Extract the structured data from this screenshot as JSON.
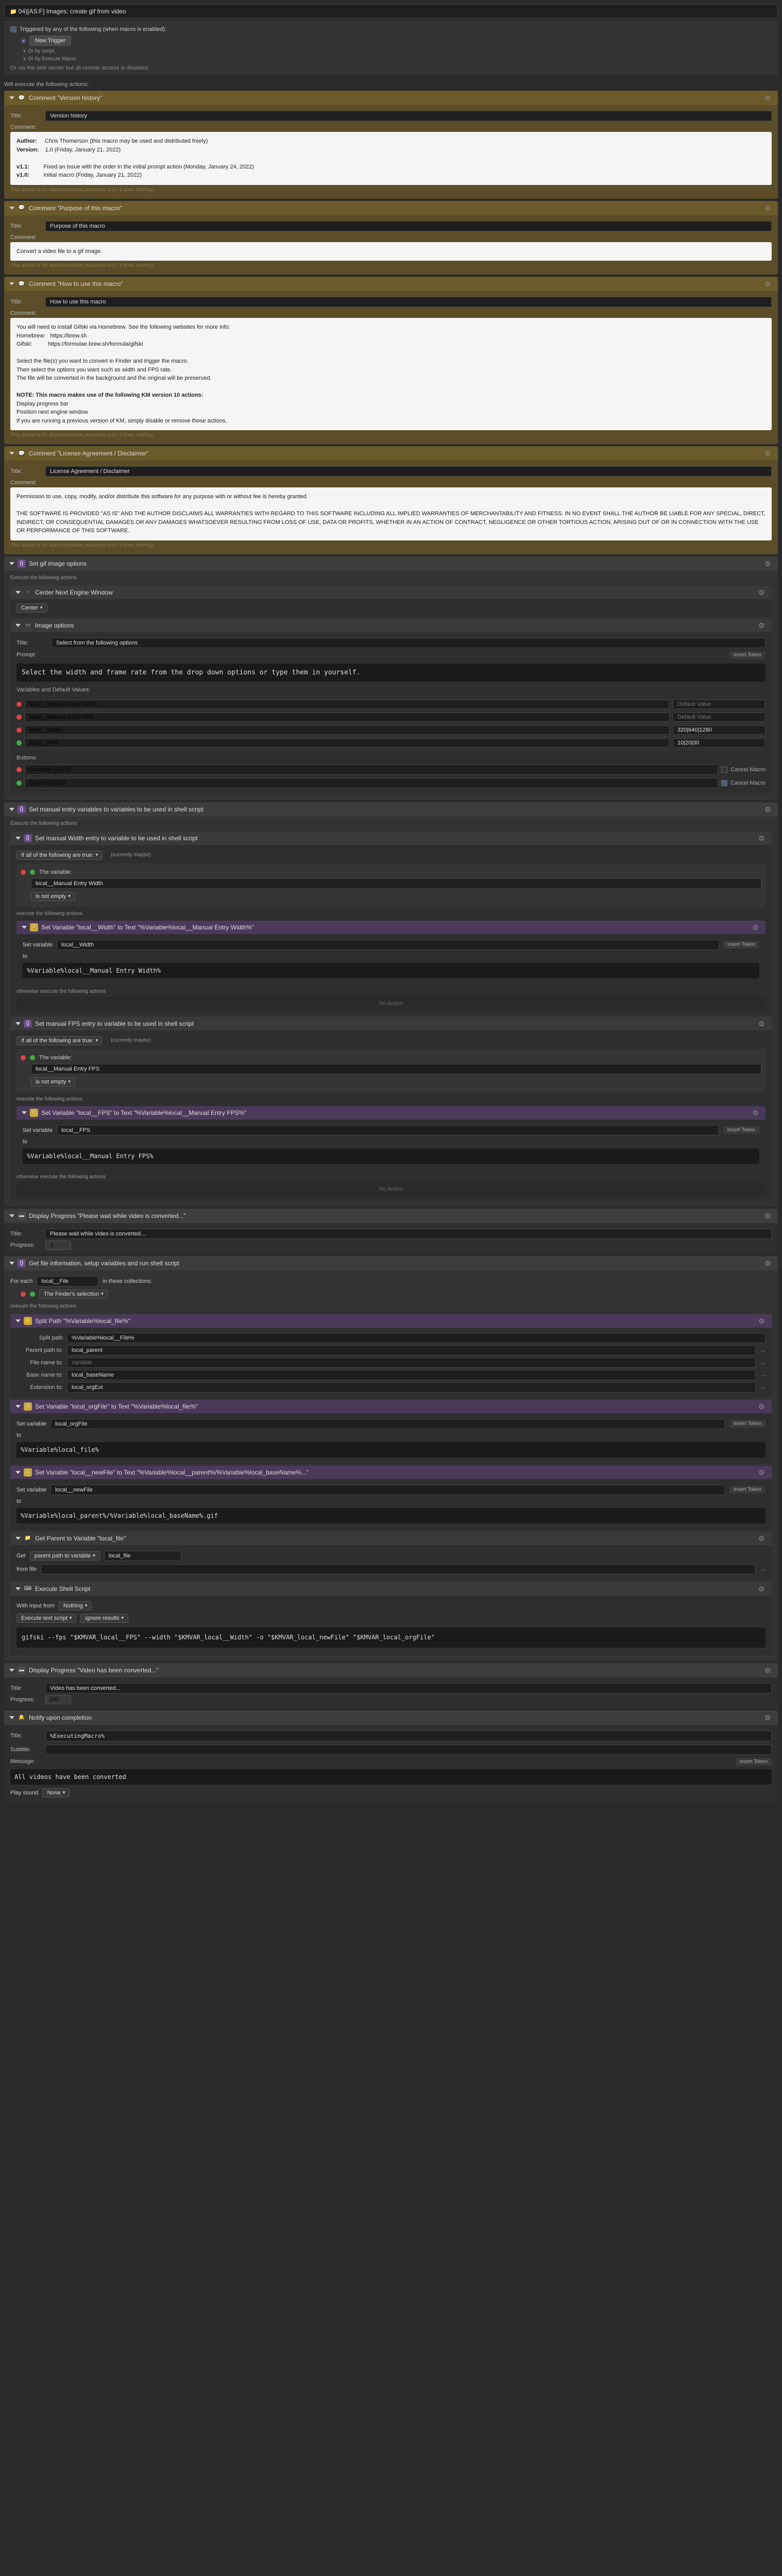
{
  "macro": {
    "title": "04)[AS:F] Images: create gif from video"
  },
  "trigger": {
    "heading": "Triggered by any of the following (when macro is enabled):",
    "new": "New Trigger",
    "sub1": "∨ Or by script,",
    "sub2": "∨ Or by Execute Macro",
    "note": "Or via the web server but all remote access is disabled."
  },
  "exec_label": "Will execute the following actions:",
  "c1": {
    "title": "Comment \"Version history\"",
    "field": "Version history",
    "label": "Comment:",
    "body_html": "<b>Author:</b>&nbsp;&nbsp;&nbsp;&nbsp;&nbsp;Chris Thomerson (this macro may be used and distributed freely)<br><b>Version:</b>&nbsp;&nbsp;&nbsp;&nbsp;1.0 (Friday, January 21, 2022)<br><br><b>v1.1:</b>&nbsp;&nbsp;&nbsp;&nbsp;&nbsp;&nbsp;&nbsp;&nbsp;&nbsp;Fixed an issue with the order in the initial prompt action (Monday, January 24, 2022)<br><b>v1.0:</b>&nbsp;&nbsp;&nbsp;&nbsp;&nbsp;&nbsp;&nbsp;&nbsp;&nbsp;Initial macro (Friday, January 21, 2022)",
    "note": "This action is for documentation purposes only; it does nothing."
  },
  "c2": {
    "title": "Comment \"Purpose of this macro\"",
    "field": "Purpose of this macro",
    "body": "Convert a video file to a gif image."
  },
  "c3": {
    "title": "Comment \"How to use this macro\"",
    "field": "How to use this macro",
    "body_html": "You will need to install Gifski via Homebrew. See the following websites for more info:<br>Homebrew:&nbsp;&nbsp;&nbsp;https://brew.sh<br>Gifski:&nbsp;&nbsp;&nbsp;&nbsp;&nbsp;&nbsp;&nbsp;&nbsp;&nbsp;&nbsp;https://formulae.brew.sh/formula/gifski<br><br>Select the file(s) you want to convert in Finder and trigger the macro.<br>Then select the options you want such as width and FPS rate.<br>The file will be converted in the background and the original will be preserved.<br><br><b>NOTE: This macro makes use of the following KM version 10 actions:</b><br>Display progress bar<br>Position next engine window<br>If you are running a previous version of KM, simply disable or remove those actions."
  },
  "c4": {
    "title": "Comment \"License Agreement / Disclaimer\"",
    "field": "License Agreement / Disclaimer",
    "perm": "Permission to use, copy, modify, and/or distribute this software for any purpose with or without fee is hereby granted.",
    "disc": "THE SOFTWARE IS PROVIDED \"AS IS\" AND THE AUTHOR DISCLAIMS ALL WARRANTIES WITH REGARD TO THIS SOFTWARE INCLUDING ALL IMPLIED WARRANTIES OF MERCHANTABILITY AND FITNESS. IN NO EVENT SHALL THE AUTHOR BE LIABLE FOR ANY SPECIAL, DIRECT, INDIRECT, OR CONSEQUENTIAL DAMAGES OR ANY DAMAGES WHATSOEVER RESULTING FROM LOSS OF USE, DATA OR PROFITS, WHETHER IN AN ACTION OF CONTRACT, NEGLIGENCE OR OTHER TORTIOUS ACTION, ARISING OUT OF OR IN CONNECTION WITH THE USE OR PERFORMANCE OF THIS SOFTWARE."
  },
  "g1": {
    "title": "Set gif image options",
    "exec": "Execute the following actions",
    "center": "Center Next Engine Window",
    "center_opt": "Center",
    "img_opt": {
      "title": "Image options",
      "sel": "Select from the following options",
      "prompt_label": "Prompt:",
      "prompt": "Select the width and frame rate from the drop down options or type them in yourself.",
      "vars_label": "Variables and Default Values:",
      "v1": {
        "n": "local__Manual Entry Width",
        "v": "Default Value"
      },
      "v2": {
        "n": "local__Manual Entry FPS",
        "v": "Default Value"
      },
      "v3": {
        "n": "local__Width",
        "v": "320|640|1280"
      },
      "v4": {
        "n": "local__FPS",
        "v": "10|20|30"
      },
      "btns_label": "Buttons:",
      "b1": "Continue (ENT)/",
      "b2": "Cancel (ESC)/",
      "cancel": "Cancel Macro"
    },
    "token": "Insert Token"
  },
  "g2": {
    "title": "Set manual entry variables to variables to be used in shell script",
    "exec": "Execute the following actions",
    "if1": {
      "title": "Set manual Width entry to variable to be used in shell script",
      "all": "If all of the following are true:",
      "impl": "(currently maybe)",
      "var_label": "The variable:",
      "var": "local__Manual Entry Width",
      "cond": "is not empty",
      "exec_label": "execute the following actions",
      "sv": {
        "title": "Set Variable \"local__Width\" to Text \"%Variable%local__Manual Entry Width%\"",
        "label": "Set variable",
        "var": "local__Width",
        "to": "to",
        "val": "%Variable%local__Manual Entry Width%"
      },
      "else": "otherwise execute the following actions",
      "noact": "No Action"
    },
    "if2": {
      "title": "Set manual FPS entry to variable to be used in shell script",
      "var": "local__Manual Entry FPS",
      "sv": {
        "title": "Set Variable \"local__FPS\" to Text \"%Variable%local__Manual Entry FPS%\"",
        "var": "local__FPS",
        "val": "%Variable%local__Manual Entry FPS%"
      }
    }
  },
  "prog1": {
    "title": "Display Progress \"Please wait while video is converted...\"",
    "field": "Please wait while video is converted...",
    "prog_label": "Progress:",
    "prog": "-1"
  },
  "g3": {
    "title": "Get file information, setup variables and run shell script",
    "for_label": "For each",
    "for_var": "local__File",
    "in": "in these collections:",
    "finder": "The Finder's selection",
    "exec": "execute the following actions",
    "split": {
      "title": "Split Path \"%Variable%local_file%\"",
      "sp_label": "Split path",
      "sp": "%Variable%local__File%",
      "pp_label": "Parent path to:",
      "pp": "local_parent",
      "fn_label": "File name to:",
      "fn": "Variable",
      "bn_label": "Base name to:",
      "bn": "local_baseName",
      "ext_label": "Extension to:",
      "ext": "local_orgExt"
    },
    "sv1": {
      "title": "Set Variable \"local_orgFile\" to Text \"%Variable%local_file%\"",
      "var": "local_orgFile",
      "val": "%Variable%local_file%"
    },
    "sv2": {
      "title": "Set Variable \"local__newFile\" to Text \"%Variable%local__parent%/%Variable%local_baseName%...\"",
      "var": "local__newFile",
      "val": "%Variable%local_parent%/%Variable%local_baseName%.gif"
    },
    "gp": {
      "title": "Get Parent to Variable \"local_file\"",
      "label": "Get",
      "opt": "parent path to variable",
      "var": "local_file",
      "from": "from file"
    },
    "sh": {
      "title": "Execute Shell Script",
      "input_label": "With input from",
      "input": "Nothing",
      "exec_label": "Execute text script",
      "res": "ignore results",
      "script": "gifski --fps \"$KMVAR_local__FPS\" --width \"$KMVAR_local__Width\" -o \"$KMVAR_local_newFile\" \"$KMVAR_local_orgFile\""
    }
  },
  "prog2": {
    "title": "Display Progress \"Video has been converted...\"",
    "field": "Video has been converted...",
    "prog": "100"
  },
  "notify": {
    "title": "Notify upon completion",
    "title_label": "Title:",
    "title_val": "%ExecutingMacro%",
    "sub_label": "Subtitle:",
    "msg_label": "Message:",
    "msg": "All videos have been converted",
    "sound_label": "Play sound",
    "sound": "None"
  },
  "labels": {
    "title": "Title:",
    "to": "to"
  }
}
